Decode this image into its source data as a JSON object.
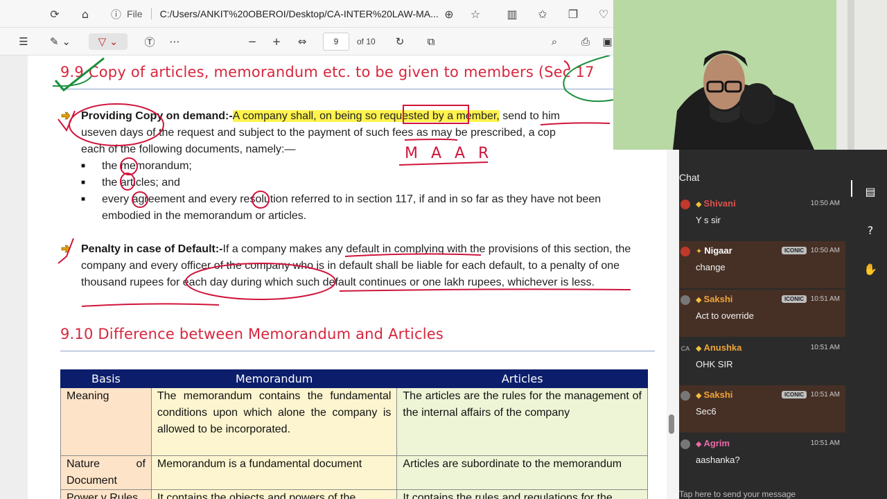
{
  "browser": {
    "file_label": "File",
    "address": "C:/Users/ANKIT%20OBEROI/Desktop/CA-INTER%20LAW-MA..."
  },
  "pdf": {
    "page_current": "9",
    "page_total": "of 10"
  },
  "document": {
    "heading_1": "9.9 Copy of articles, memorandum etc. to be given to members (Sec 17",
    "para1_bold": "Providing Copy on demand:-",
    "para1_highlight": "A company shall, on being so requested by a member,",
    "para1_rest_line1": " send to him",
    "para1_line2": "useven days of the request and subject to the payment of such fees as may be prescribed, a cop",
    "para1_line3": "each of the following documents, namely:—",
    "bullets": [
      "the memorandum;",
      "the articles; and",
      "every agreement and every resolution referred to in section 117, if and in so far as they have not been embodied in the memorandum or articles."
    ],
    "para2_bold": "Penalty in case of Default:-",
    "para2_text": "If a company makes any default in complying with the provisions of this section, the company and every officer of the company who is in default shall be liable for each default, to a penalty of one thousand rupees for each day during which such default continues or one lakh rupees, whichever is less.",
    "heading_2": "9.10 Difference between Memorandum and Articles",
    "annotation_maar": "M A A R"
  },
  "table": {
    "headers": [
      "Basis",
      "Memorandum",
      "Articles"
    ],
    "rows": [
      [
        "Meaning",
        "The memorandum contains the fundamental conditions upon which alone the company is allowed to be incorporated.",
        "The articles are the rules for the management of the internal affairs of the company"
      ],
      [
        "Nature of Document",
        "Memorandum is a fundamental document",
        "Articles are subordinate to the memorandum"
      ],
      [
        "Power v Rules",
        "It contains the objects and powers of the",
        "It contains the rules and regulations for the"
      ]
    ]
  },
  "chat": {
    "title": "Chat",
    "messages": [
      {
        "name": "Shivani",
        "time": "10:50 AM",
        "text": "Y s sir",
        "badge": "",
        "color": "#d9534f"
      },
      {
        "name": "Nigaar",
        "time": "10:50 AM",
        "text": "change",
        "badge": "ICONIC",
        "color": "#ffffff"
      },
      {
        "name": "Sakshi",
        "time": "10:51 AM",
        "text": "Act to override",
        "badge": "ICONIC",
        "color": "#f0a43a"
      },
      {
        "name": "Anushka",
        "time": "10:51 AM",
        "text": "OHK SIR",
        "badge": "",
        "color": "#f0a43a"
      },
      {
        "name": "Sakshi",
        "time": "10:51 AM",
        "text": "Sec6",
        "badge": "ICONIC",
        "color": "#f0a43a"
      },
      {
        "name": "Agrim",
        "time": "10:51 AM",
        "text": "aashanka?",
        "badge": "",
        "color": "#e86aa8"
      }
    ],
    "input_placeholder": "Tap here to send your message"
  },
  "colors": {
    "heading_red": "#d7263d",
    "table_header": "#0c1e6b",
    "chat_bg": "#2b2b2b",
    "chat_alt_bg": "#463025",
    "ink_red": "#d0143a",
    "ink_green": "#1a8f3c"
  }
}
